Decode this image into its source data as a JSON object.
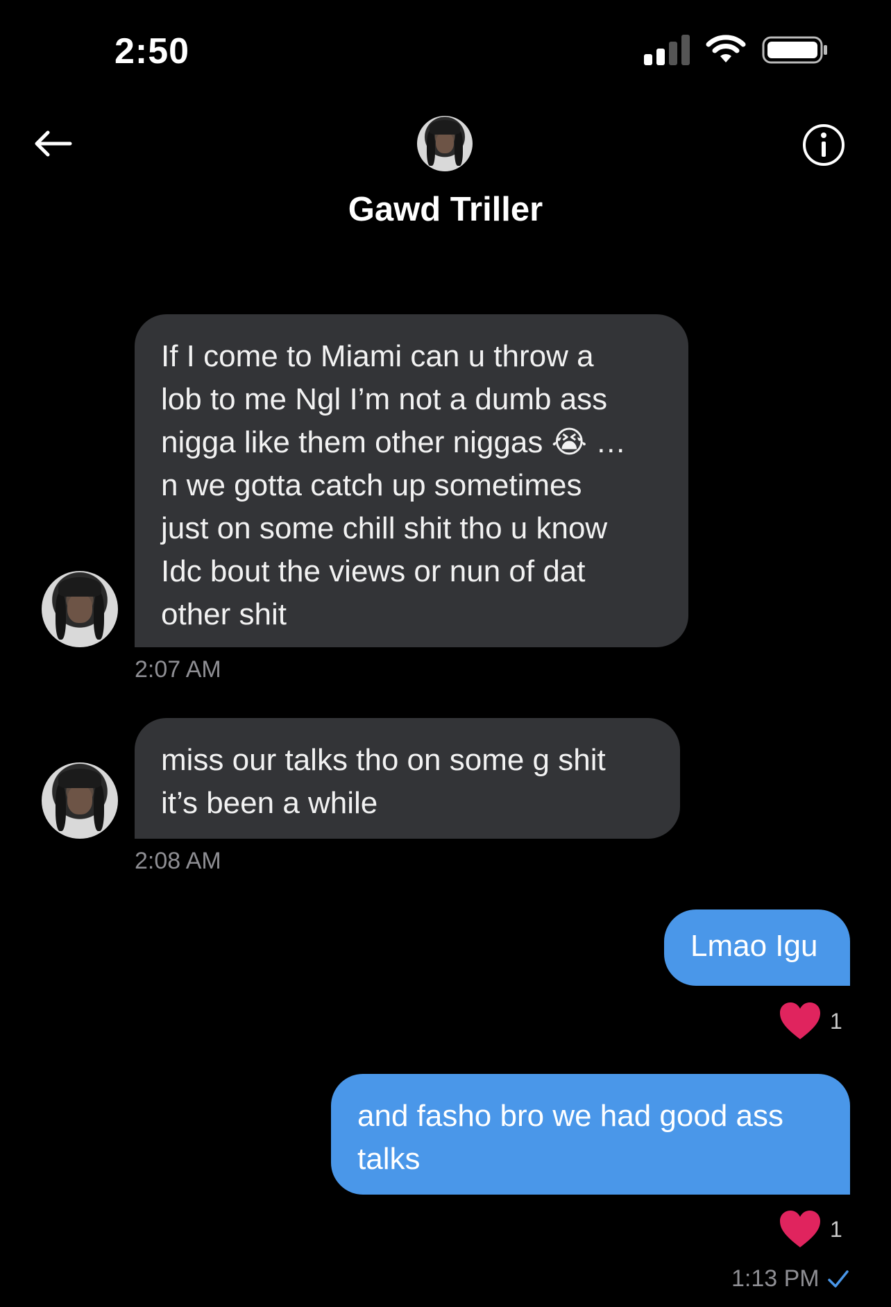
{
  "status_bar": {
    "time": "2:50",
    "icons": [
      "signal-icon",
      "wifi-icon",
      "battery-icon"
    ]
  },
  "header": {
    "back_icon": "back-arrow-icon",
    "info_icon": "info-icon",
    "contact_name": "Gawd Triller"
  },
  "messages": [
    {
      "direction": "incoming",
      "lines": [
        "If I come to Miami can u throw a",
        "lob to me Ngl I’m not a dumb ass",
        "nigga like them other niggas 😭 …",
        "n we gotta catch up sometimes",
        "just on some chill shit tho u know",
        "Idc bout the views or nun of dat",
        "other shit"
      ],
      "timestamp": "2:07 AM"
    },
    {
      "direction": "incoming",
      "lines": [
        "miss our talks tho on some g shit",
        "it’s been a while"
      ],
      "timestamp": "2:08 AM"
    },
    {
      "direction": "outgoing",
      "lines": [
        "Lmao Igu"
      ],
      "reaction": {
        "icon": "heart-icon",
        "count": "1"
      }
    },
    {
      "direction": "outgoing",
      "lines": [
        "and fasho bro we had good ass",
        "talks"
      ],
      "reaction": {
        "icon": "heart-icon",
        "count": "1"
      },
      "timestamp": "1:13 PM",
      "read_icon": "checkmark-icon"
    }
  ],
  "colors": {
    "background": "#000000",
    "incoming_bubble": "#333437",
    "outgoing_bubble": "#4a97e9",
    "timestamp": "#8e8e93",
    "heart": "#e0245e",
    "check": "#4a97e9"
  }
}
